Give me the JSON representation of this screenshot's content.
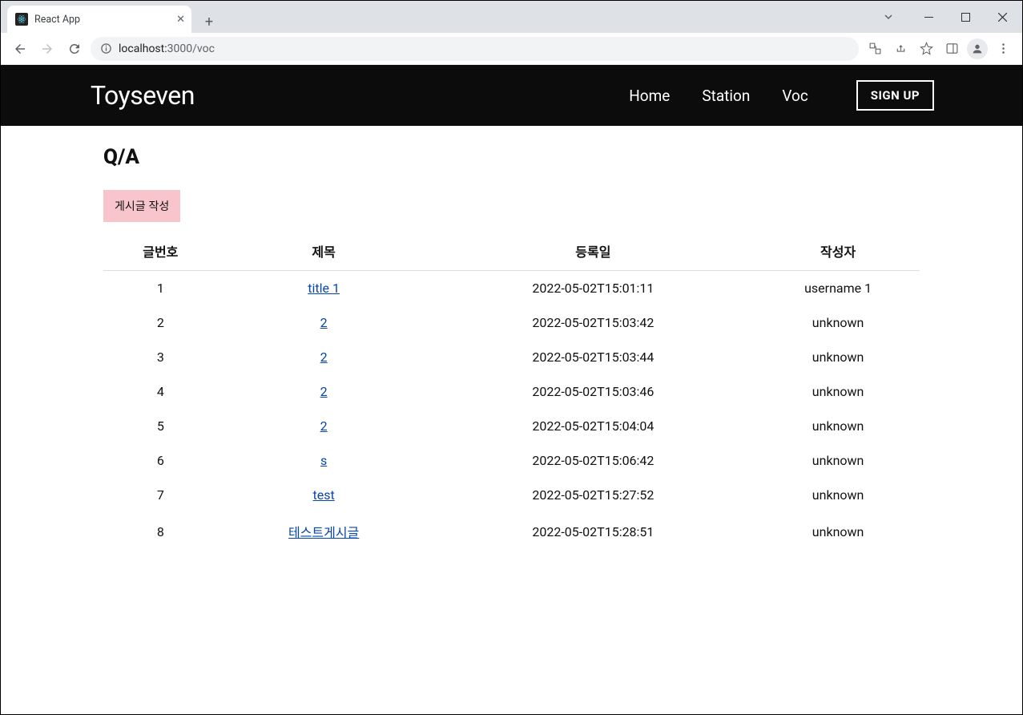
{
  "browser": {
    "tab_title": "React App",
    "url_host": "localhost:",
    "url_port": "3000",
    "url_path": "/voc"
  },
  "navbar": {
    "brand": "Toyseven",
    "links": [
      "Home",
      "Station",
      "Voc"
    ],
    "signup": "SIGN UP"
  },
  "page": {
    "title": "Q/A",
    "write_button": "게시글 작성"
  },
  "table": {
    "headers": {
      "no": "글번호",
      "title": "제목",
      "date": "등록일",
      "author": "작성자"
    },
    "rows": [
      {
        "no": "1",
        "title": "title 1",
        "date": "2022-05-02T15:01:11",
        "author": "username 1"
      },
      {
        "no": "2",
        "title": "2",
        "date": "2022-05-02T15:03:42",
        "author": "unknown"
      },
      {
        "no": "3",
        "title": "2",
        "date": "2022-05-02T15:03:44",
        "author": "unknown"
      },
      {
        "no": "4",
        "title": "2",
        "date": "2022-05-02T15:03:46",
        "author": "unknown"
      },
      {
        "no": "5",
        "title": "2",
        "date": "2022-05-02T15:04:04",
        "author": "unknown"
      },
      {
        "no": "6",
        "title": "s",
        "date": "2022-05-02T15:06:42",
        "author": "unknown"
      },
      {
        "no": "7",
        "title": "test",
        "date": "2022-05-02T15:27:52",
        "author": "unknown"
      },
      {
        "no": "8",
        "title": "테스트게시글",
        "date": "2022-05-02T15:28:51",
        "author": "unknown"
      }
    ]
  }
}
